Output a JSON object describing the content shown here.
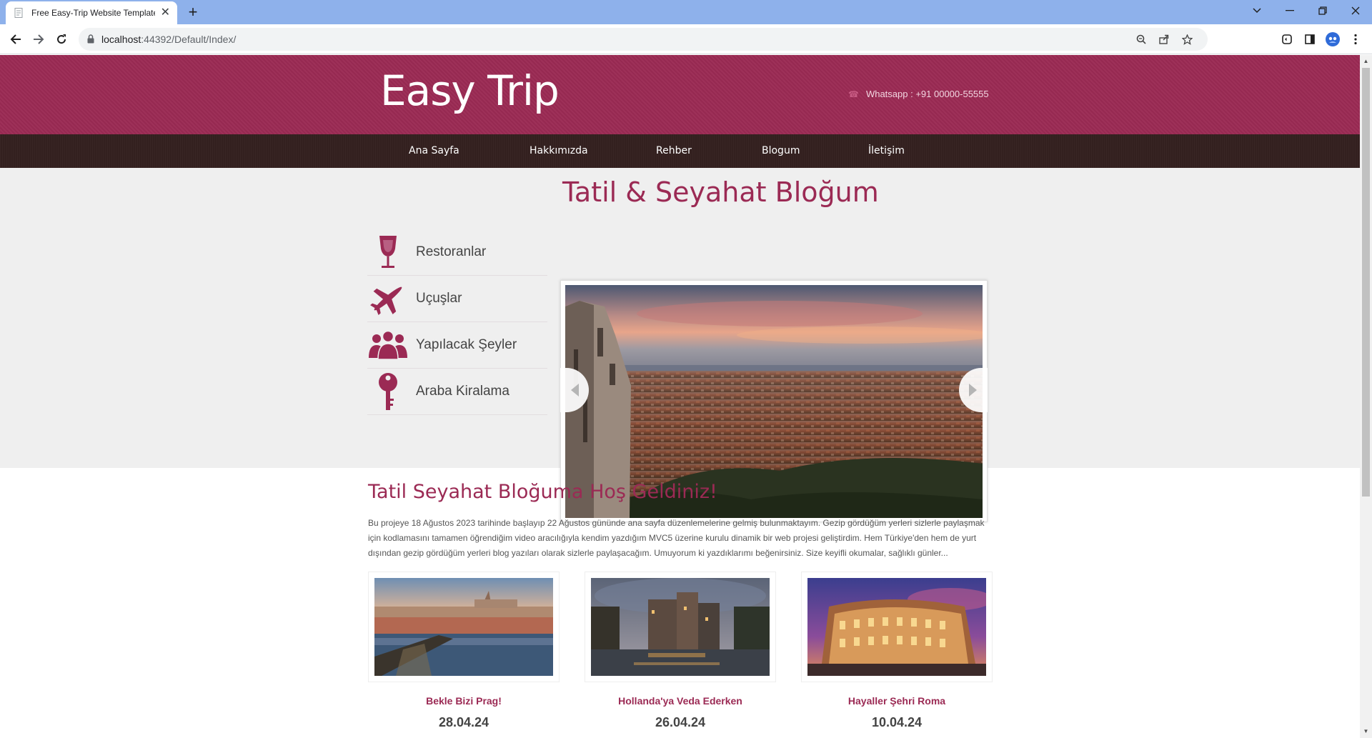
{
  "browser": {
    "tab_title": "Free Easy-Trip Website Template",
    "url_host": "localhost",
    "url_rest": ":44392/Default/Index/"
  },
  "header": {
    "logo": "Easy Trip",
    "whatsapp": "Whatsapp : +91 00000-55555"
  },
  "nav": {
    "items": [
      "Ana Sayfa",
      "Hakkımızda",
      "Rehber",
      "Blogum",
      "İletişim"
    ]
  },
  "banner": {
    "title": "Tatil & Seyahat Bloğum",
    "features": [
      {
        "label": "Restoranlar",
        "icon": "wine-glass-icon"
      },
      {
        "label": "Uçuşlar",
        "icon": "airplane-icon"
      },
      {
        "label": "Yapılacak Şeyler",
        "icon": "people-icon"
      },
      {
        "label": "Araba Kiralama",
        "icon": "key-icon"
      }
    ]
  },
  "welcome": {
    "title": "Tatil Seyahat Bloğuma Hoş Geldiniz!",
    "text": "Bu projeye 18 Ağustos 2023 tarihinde başlayıp 22 Ağustos gününde ana sayfa düzenlemelerine gelmiş bulunmaktayım. Gezip gördüğüm yerleri sizlerle paylaşmak için kodlamasını tamamen öğrendiğim video aracılığıyla kendim yazdığım MVC5 üzerine kurulu dinamik bir web projesi geliştirdim. Hem Türkiye'den hem de yurt dışından gezip gördüğüm yerleri blog yazıları olarak sizlerle paylaşacağım. Umuyorum ki yazdıklarımı beğenirsiniz. Size keyifli okumalar, sağlıklı günler..."
  },
  "posts": [
    {
      "title": "Bekle Bizi Prag!",
      "date": "28.04.24"
    },
    {
      "title": "Hollanda'ya Veda Ederken",
      "date": "26.04.24"
    },
    {
      "title": "Hayaller Şehri Roma",
      "date": "10.04.24"
    }
  ],
  "colors": {
    "brand": "#9b2a54",
    "nav_bg": "#33201f",
    "banner_bg": "#efefef",
    "chrome_tabbar": "#8eb1eb"
  }
}
